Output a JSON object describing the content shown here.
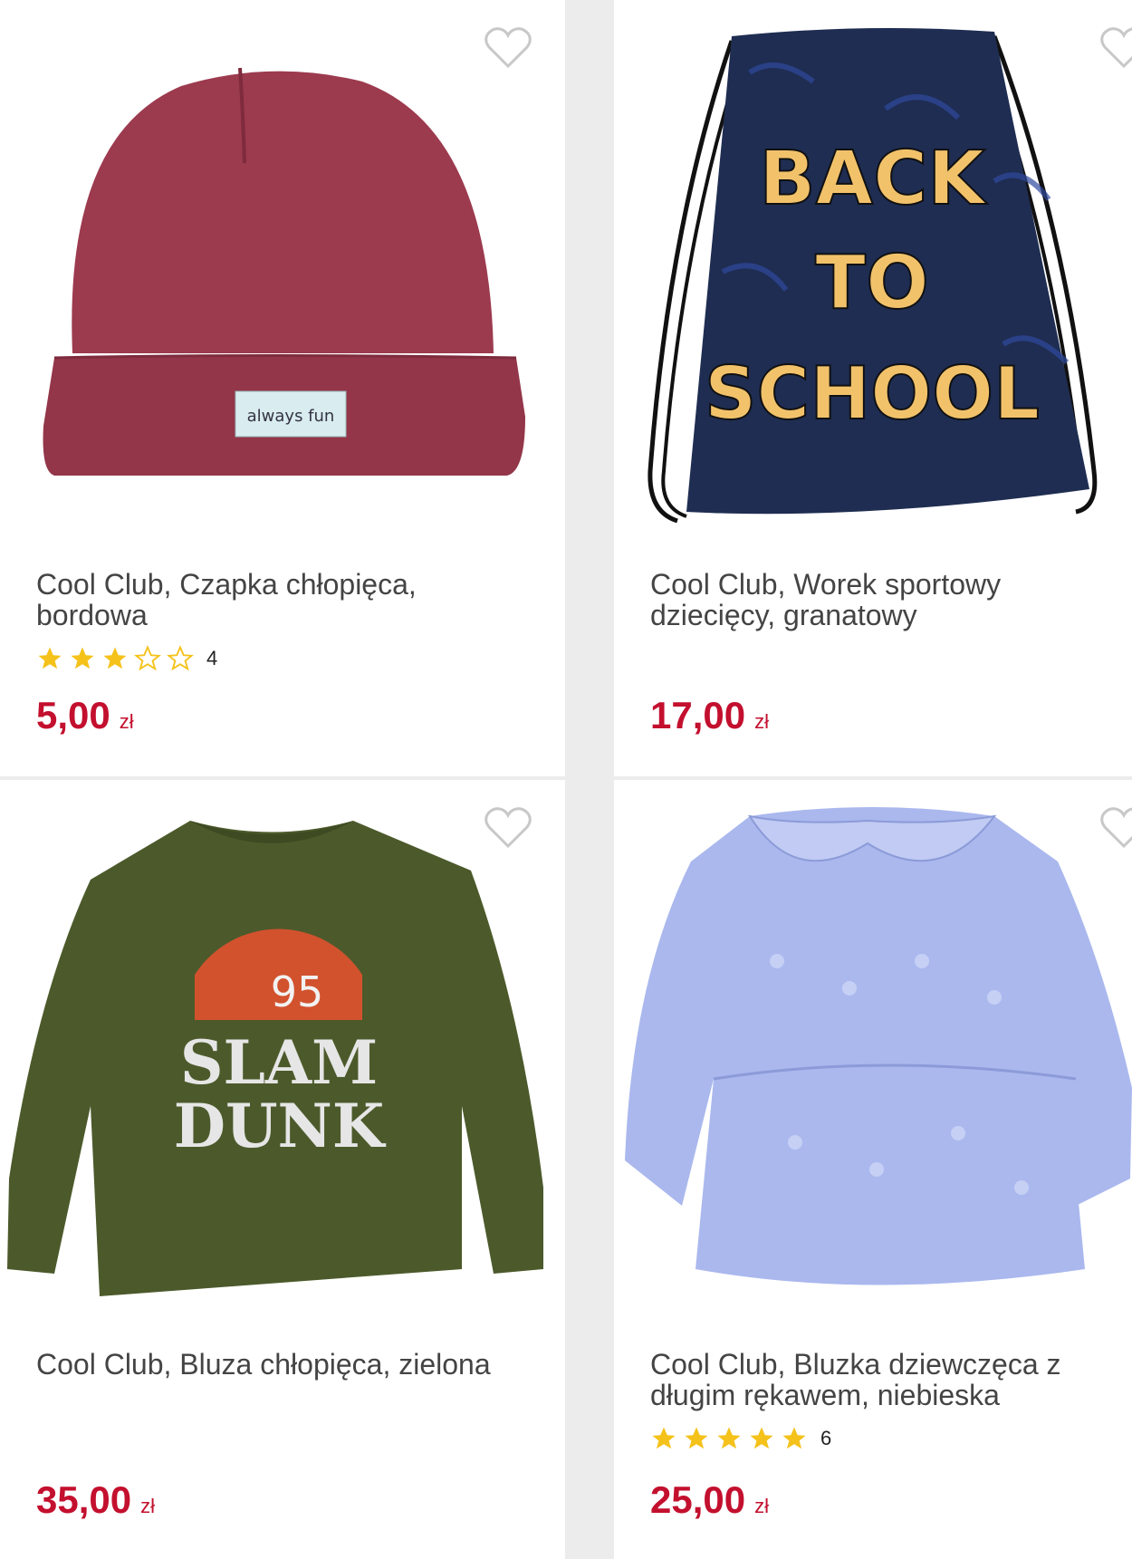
{
  "products": [
    {
      "title": "Cool Club, Czapka chłopięca, bordowa",
      "rating_count": "4",
      "rating": 3,
      "price": "5,00",
      "currency": "zł",
      "image_label": "always fun",
      "colors": {
        "hat": "#9c3a4e",
        "hat_dark": "#7e2b3d"
      }
    },
    {
      "title": "Cool Club, Worek sportowy dziecięcy, granatowy",
      "price": "17,00",
      "currency": "zł",
      "image_lines": [
        "BACK",
        "TO",
        "SCHOOL"
      ],
      "colors": {
        "bag": "#1f2d52",
        "text": "#f2c26b"
      }
    },
    {
      "title": "Cool Club, Bluza chłopięca, zielona",
      "price": "35,00",
      "currency": "zł",
      "image_lines": [
        "95",
        "SLAM",
        "DUNK"
      ],
      "colors": {
        "sweater": "#4c5a2b",
        "ball": "#d2522e"
      }
    },
    {
      "title": "Cool Club, Bluzka dziewczęca z długim rękawem, niebieska",
      "rating_count": "6",
      "rating": 5,
      "price": "25,00",
      "currency": "zł",
      "colors": {
        "blouse": "#aab8ee"
      }
    }
  ],
  "colors": {
    "price": "#c3102e",
    "star": "#f5c21b",
    "background": "#ececec"
  }
}
